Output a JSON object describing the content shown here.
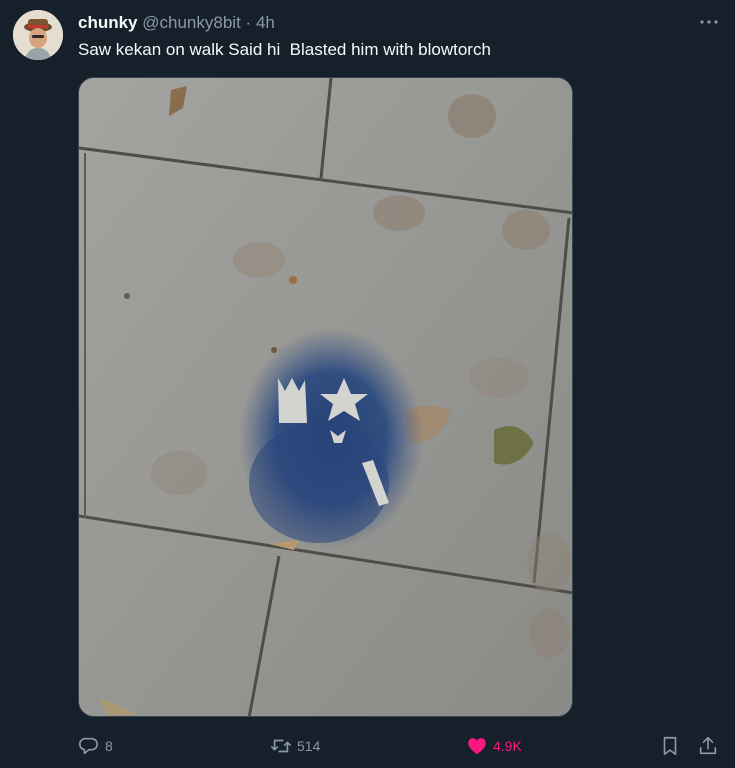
{
  "tweet": {
    "author_name": "chunky",
    "handle": "@chunky8bit",
    "separator": "·",
    "time": "4h",
    "text": "Saw kekan on walk Said hi  Blasted him with blowtorch"
  },
  "actions": {
    "replies": "8",
    "reposts": "514",
    "likes": "4.9K"
  },
  "colors": {
    "background": "#15202b",
    "text": "#f7f9f9",
    "secondary": "#8b98a5",
    "like": "#f91880"
  },
  "icons": {
    "more": "more-icon",
    "reply": "reply-icon",
    "repost": "repost-icon",
    "like": "heart-icon",
    "bookmark": "bookmark-icon",
    "share": "share-icon"
  }
}
